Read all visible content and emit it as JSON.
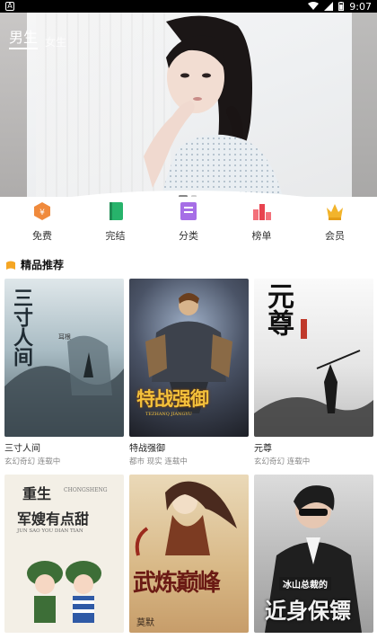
{
  "status": {
    "time": "9:07",
    "notif": "A"
  },
  "hero": {
    "tabs": [
      {
        "label": "男生",
        "active": true
      },
      {
        "label": "女生",
        "active": false
      }
    ]
  },
  "nav": {
    "items": [
      {
        "label": "免费",
        "icon": "free-icon"
      },
      {
        "label": "完结",
        "icon": "book-icon"
      },
      {
        "label": "分类",
        "icon": "category-icon"
      },
      {
        "label": "榜单",
        "icon": "ranking-icon"
      },
      {
        "label": "会员",
        "icon": "crown-icon"
      }
    ]
  },
  "section": {
    "title": "精品推荐"
  },
  "books": [
    {
      "title": "三寸人间",
      "meta": "玄幻奇幻  连载中",
      "cover_text": "三寸人间",
      "cover_author": "耳根"
    },
    {
      "title": "特战强御",
      "meta": "都市  现实  连载中",
      "cover_text": "特战强御",
      "cover_sub": "TEZHANQ  JIANGYU"
    },
    {
      "title": "元尊",
      "meta": "玄幻奇幻  连载中",
      "cover_text": "元尊"
    },
    {
      "title": "",
      "meta": "",
      "cover_text_1": "重生",
      "cover_text_2": "军嫂有点甜",
      "cover_pinyin": "CHONGSHENG",
      "cover_pinyin_2": "JUN SAO YOU DIAN TIAN"
    },
    {
      "title": "",
      "meta": "",
      "cover_text": "武炼巅峰",
      "cover_author": "莫默"
    },
    {
      "title": "",
      "meta": "",
      "cover_text": "冰山总裁的",
      "cover_text_2": "近身保镖"
    }
  ]
}
